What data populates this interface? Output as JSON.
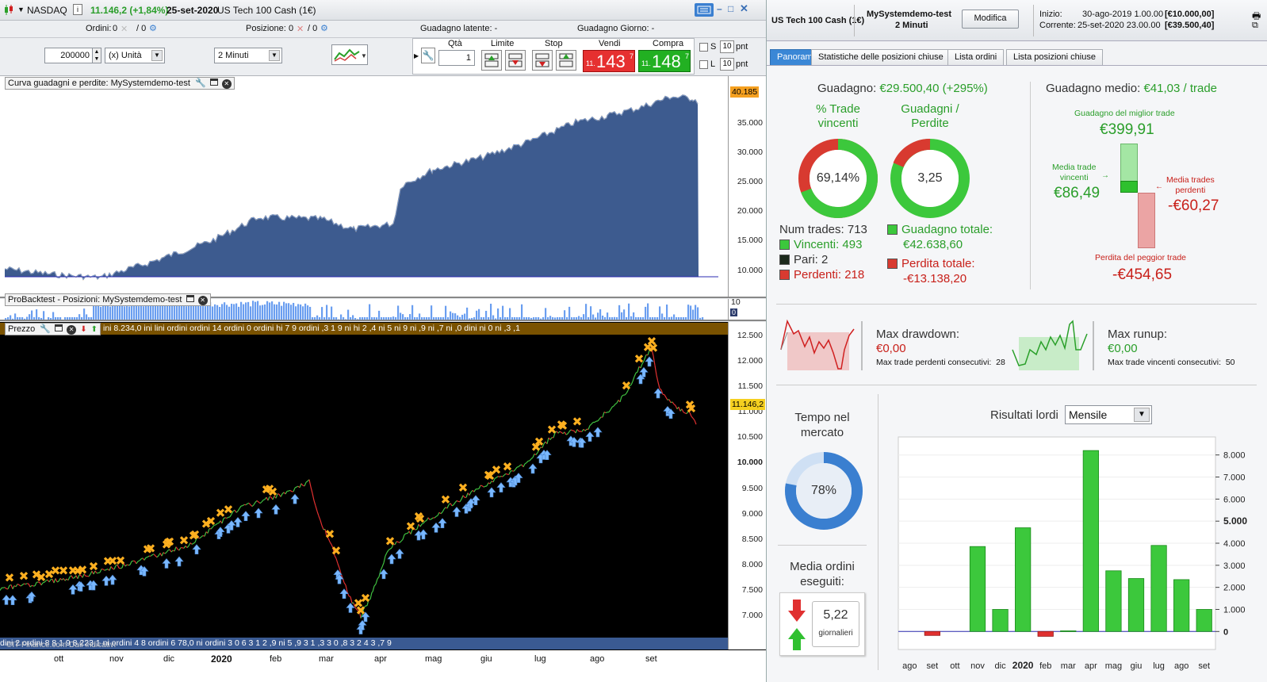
{
  "topbar": {
    "symbol": "NASDAQ",
    "price_change": "11.146,2 (+1,84%)",
    "date": "25-set-2020",
    "instrument": "US Tech 100 Cash (1€)"
  },
  "row2": {
    "ordini_label": "Ordini:",
    "ordini_value1": "0",
    "ordini_value2": "/ 0",
    "posizione_label": "Posizione:",
    "posizione_value1": "0",
    "posizione_value2": "/ 0",
    "guadagno_latente": "Guadagno latente: -",
    "guadagno_giorno": "Guadagno Giorno: -"
  },
  "row3": {
    "quantity": "200000",
    "unit_select": "(x) Unità",
    "timeframe_select": "2 Minuti",
    "qta_label": "Qtà",
    "qta_value": "1",
    "limite_label": "Limite",
    "stop_label": "Stop",
    "vendi_label": "Vendi",
    "compra_label": "Compra",
    "sell_prefix": "11.",
    "sell_big": "143",
    "sell_sup": "7",
    "buy_prefix": "11.",
    "buy_big": "148",
    "buy_sup": "7",
    "s_label": "S",
    "l_label": "L",
    "pnt_s": "10",
    "pnt_l": "10",
    "pnt_label": "pnt"
  },
  "equity_panel": {
    "title": "Curva guadagni e perdite: MySystemdemo-test",
    "last_value": "40.185",
    "ticks": [
      "35.000",
      "30.000",
      "25.000",
      "20.000",
      "15.000",
      "10.000"
    ]
  },
  "positions_panel": {
    "title": "ProBacktest - Posizioni: MySystemdemo-test",
    "tick_top": "10",
    "tick_bottom": "0"
  },
  "price_panel": {
    "title": "Prezzo",
    "order_strip_text": "ini 8.234,0 ini lini ordini ordini  14 ordini  0  ordini hi 7  9 ordini  ,3  1  9  ni  hi  2  ,4  ni 5  ni  9  ni  ,9  ni  ,7  ni  ,0  dini  ni  0  ni  ,3  ,1",
    "bottom_strip_text": "dini  2 ordini  8  8  1 9  8.223,1  ni  ordini  4  8  ordini  6  78,0  ni  ordini 3  0  6  3  1  2  ,9  ni  5  ,9  3  1  ,3  3  0  ,8  3  2  4  3  ,7  9",
    "watermark": "©IT-Finance.com Dati indicativi",
    "last_value": "11.146,2",
    "ticks": [
      "12.500",
      "12.000",
      "11.500",
      "11.000",
      "10.500",
      "10.000",
      "9.500",
      "9.000",
      "8.500",
      "8.000",
      "7.500",
      "7.000"
    ],
    "months": [
      "ott",
      "nov",
      "dic",
      "2020",
      "feb",
      "mar",
      "apr",
      "mag",
      "giu",
      "lug",
      "ago",
      "set"
    ]
  },
  "right_header": {
    "instrument": "US Tech 100 Cash (1€)",
    "system_name": "MySystemdemo-test",
    "timeframe": "2 Minuti",
    "modify_button": "Modifica",
    "inizio_label": "Inizio:",
    "inizio_date": "30-ago-2019 1.00.00",
    "inizio_value": "[€10.000,00]",
    "corrente_label": "Corrente:",
    "corrente_date": "25-set-2020 23.00.00",
    "corrente_value": "[€39.500,40]"
  },
  "tabs": [
    "Panoramica",
    "Statistiche delle posizioni chiuse",
    "Lista ordini",
    "Lista posizioni chiuse"
  ],
  "overview": {
    "guadagno_label": "Guadagno:",
    "guadagno_value": "€29.500,40 (+295%)",
    "pct_trade_label1": "% Trade",
    "pct_trade_label2": "vincenti",
    "pct_trade_value": "69,14%",
    "pct_trade_fraction": 0.6914,
    "gp_label1": "Guadagni /",
    "gp_label2": "Perdite",
    "gp_value": "3,25",
    "num_trades": "Num trades: 713",
    "vincenti": "Vincenti: 493",
    "pari": "Pari: 2",
    "perdenti": "Perdenti: 218",
    "guadagno_totale_label": "Guadagno totale:",
    "guadagno_totale": "€42.638,60",
    "perdita_totale_label": "Perdita totale:",
    "perdita_totale": "-€13.138,20",
    "guadagno_medio_label": "Guadagno medio:",
    "guadagno_medio_value": "€41,03 / trade",
    "miglior_trade_label": "Guadagno del miglior trade",
    "miglior_trade": "€399,91",
    "media_vincenti_label1": "Media trade",
    "media_vincenti_label2": "vincenti",
    "media_vincenti": "€86,49",
    "media_perdenti_label1": "Media trades",
    "media_perdenti_label2": "perdenti",
    "media_perdenti": "-€60,27",
    "peggior_trade_label": "Perdita del peggior trade",
    "peggior_trade": "-€454,65",
    "max_drawdown_label": "Max drawdown:",
    "max_drawdown": "€0,00",
    "max_perdenti_consec": "Max trade perdenti consecutivi:  28",
    "max_runup_label": "Max runup:",
    "max_runup": "€0,00",
    "max_vincenti_consec": "Max trade vincenti consecutivi:  50",
    "tempo_label1": "Tempo nel",
    "tempo_label2": "mercato",
    "tempo_value": "78%",
    "tempo_fraction": 0.78,
    "media_ordini_label1": "Media ordini",
    "media_ordini_label2": "eseguiti:",
    "media_ordini_value": "5,22",
    "media_ordini_unit": "giornalieri",
    "risultati_label": "Risultati lordi",
    "risultati_select": "Mensile"
  },
  "chart_data": {
    "type": "bar",
    "title": "Risultati lordi",
    "categories": [
      "ago",
      "set",
      "ott",
      "nov",
      "dic",
      "2020",
      "feb",
      "mar",
      "apr",
      "mag",
      "giu",
      "lug",
      "ago",
      "set"
    ],
    "values": [
      0,
      -180,
      0,
      3850,
      1000,
      4700,
      -220,
      30,
      8200,
      2750,
      2400,
      3900,
      2350,
      1000
    ],
    "ylim": [
      -600,
      8600
    ],
    "yticks": [
      "8.000",
      "7.000",
      "6.000",
      "5.000",
      "4.000",
      "3.000",
      "2.000",
      "1.000",
      "0"
    ],
    "colors": {
      "positive": "#3cc83c",
      "negative": "#e03030"
    }
  }
}
